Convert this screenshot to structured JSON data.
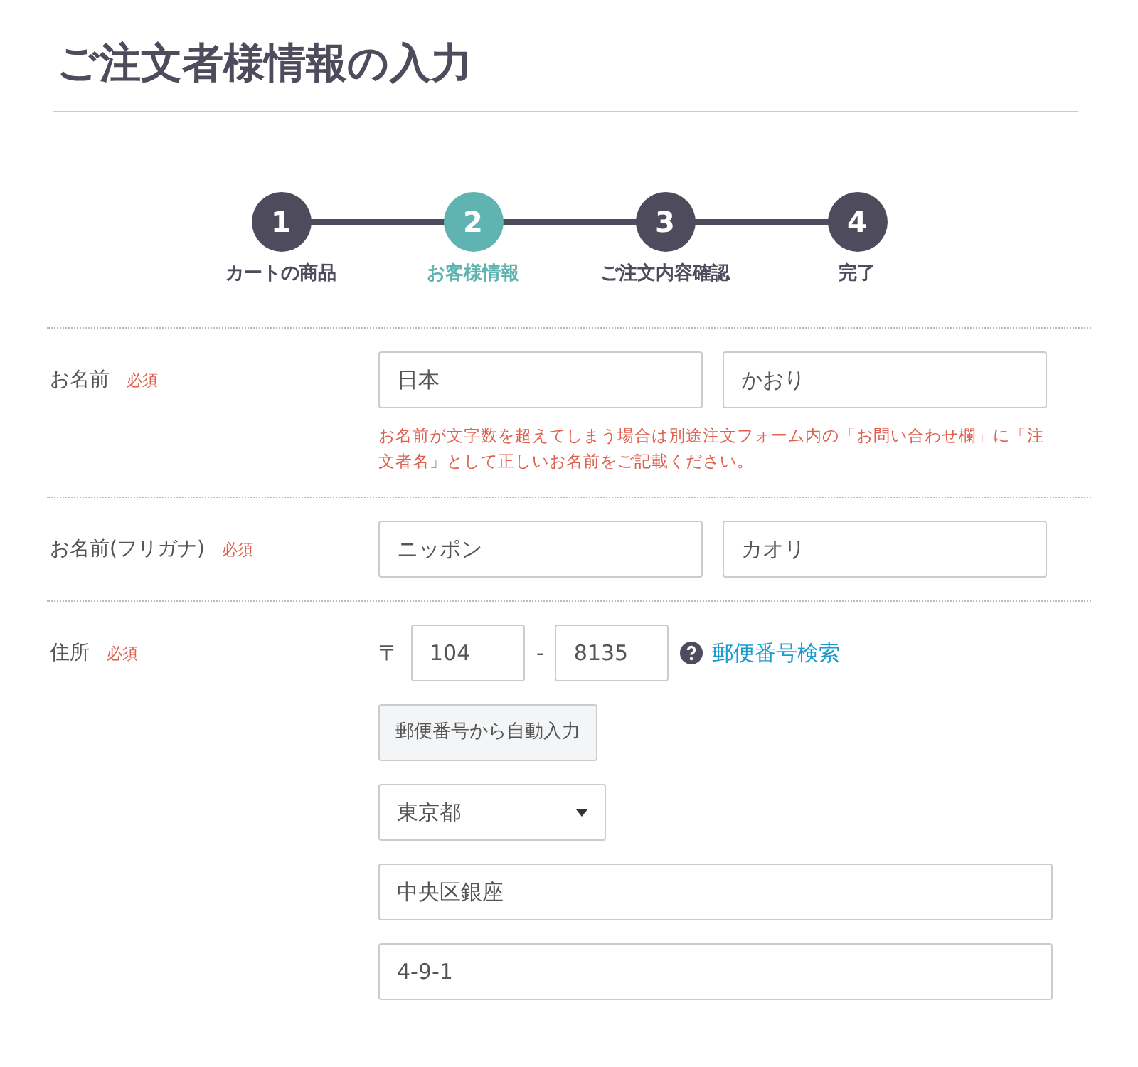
{
  "title": "ご注文者様情報の入力",
  "steps": [
    {
      "number": "1",
      "label": "カートの商品",
      "selected": false
    },
    {
      "number": "2",
      "label": "お客様情報",
      "selected": true
    },
    {
      "number": "3",
      "label": "ご注文内容確認",
      "selected": false
    },
    {
      "number": "4",
      "label": "完了",
      "selected": false
    }
  ],
  "name_row": {
    "label": "お名前",
    "required": "必須",
    "fields": [
      {
        "value": "日本"
      },
      {
        "value": "かおり"
      }
    ],
    "note": "お名前が文字数を超えてしまう場合は別途注文フォーム内の「お問い合わせ欄」に「注文者名」として正しいお名前をご記載ください。"
  },
  "kana_row": {
    "label": "お名前(フリガナ)",
    "required": "必須",
    "fields": [
      {
        "value": "ニッポン"
      },
      {
        "value": "カオリ"
      }
    ]
  },
  "address_row": {
    "label": "住所",
    "required": "必須",
    "postal_mark": "〒",
    "zip1": "104",
    "separator": "-",
    "zip2": "8135",
    "zip_search_link": "郵便番号検索",
    "autofill_button": "郵便番号から自動入力",
    "prefecture": "東京都",
    "city": "中央区銀座",
    "street": "4-9-1"
  }
}
